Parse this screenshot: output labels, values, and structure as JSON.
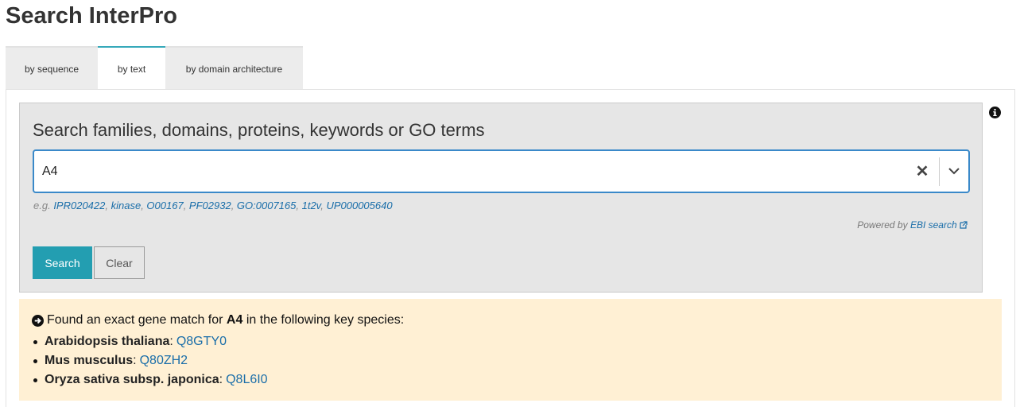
{
  "page": {
    "title": "Search InterPro"
  },
  "tabs": [
    {
      "label": "by sequence",
      "active": false
    },
    {
      "label": "by text",
      "active": true
    },
    {
      "label": "by domain architecture",
      "active": false
    }
  ],
  "search": {
    "heading": "Search families, domains, proteins, keywords or GO terms",
    "input_value": "A4",
    "examples_prefix": "e.g.",
    "examples": [
      "IPR020422",
      "kinase",
      "O00167",
      "PF02932",
      "GO:0007165",
      "1t2v",
      "UP000005640"
    ],
    "powered_prefix": "Powered by",
    "powered_link": "EBI search",
    "search_button": "Search",
    "clear_button": "Clear"
  },
  "callout": {
    "intro_before": "Found an exact gene match for",
    "query": "A4",
    "intro_after": "in the following key species:",
    "species": [
      {
        "name": "Arabidopsis thaliana",
        "accession": "Q8GTY0"
      },
      {
        "name": "Mus musculus",
        "accession": "Q80ZH2"
      },
      {
        "name": "Oryza sativa subsp. japonica",
        "accession": "Q8L6I0"
      }
    ]
  },
  "icons": {
    "info": "info-circle-icon",
    "clear": "close-icon",
    "dropdown": "chevron-down-icon",
    "callout": "arrow-circle-right-icon",
    "external": "external-link-icon"
  },
  "colors": {
    "accent": "#239eb1",
    "input_border": "#3a89c9",
    "link": "#1a6ea9",
    "callout_bg": "#fff0d4"
  }
}
